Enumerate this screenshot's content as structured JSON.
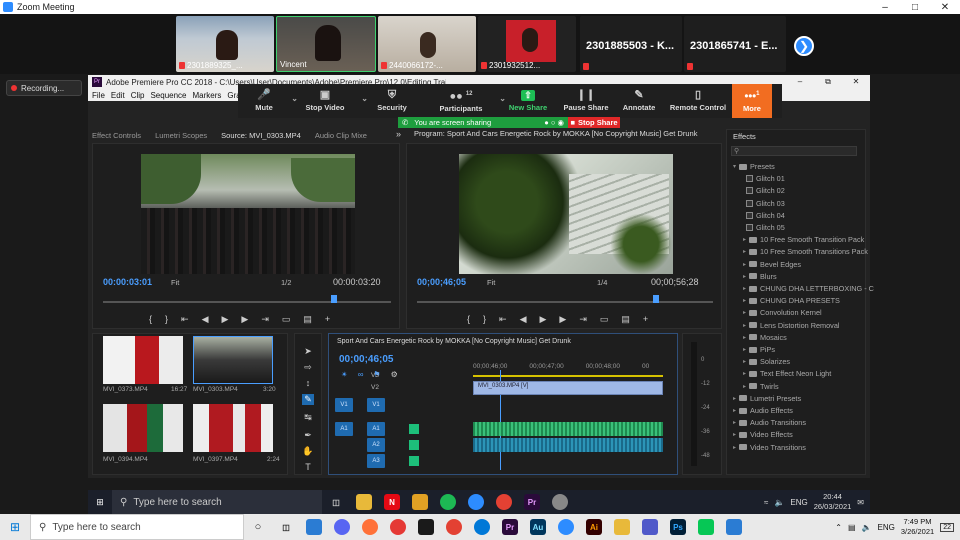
{
  "zoom": {
    "window_title": "Zoom Meeting",
    "participants": [
      {
        "name": "2301889325_..."
      },
      {
        "name": "Vincent"
      },
      {
        "name": "2440066172-..."
      },
      {
        "name": "2301932512..."
      }
    ],
    "big_names": [
      "2301885503 - K...",
      "2301865741 - E..."
    ],
    "recording_label": "Recording...",
    "toolbar": {
      "mute": "Mute",
      "stop_video": "Stop Video",
      "security": "Security",
      "participants": "Participants",
      "participants_count": "12",
      "new_share": "New Share",
      "pause_share": "Pause Share",
      "annotate": "Annotate",
      "remote_control": "Remote Control",
      "more": "More",
      "more_badge": "1"
    },
    "sharing_text": "You are screen sharing",
    "stop_share": "Stop Share"
  },
  "premiere": {
    "title": "Adobe Premiere Pro CC 2018 - C:\\Users\\User\\Documents\\Adobe\\Premiere Pro\\12.0\\Editing Training *",
    "menu": [
      "File",
      "Edit",
      "Clip",
      "Sequence",
      "Markers",
      "Graphics"
    ],
    "source_tabs": [
      "Effect Controls",
      "Lumetri Scopes",
      "Source: MVI_0303.MP4",
      "Audio Clip Mixe"
    ],
    "program_tab": "Program: Sport And Cars Energetic Rock by MOKKA [No Copyright Music] Get Drunk",
    "source": {
      "timecode": "00:00:03:01",
      "fit": "Fit",
      "ratio": "1/2",
      "duration": "00:00:03:20"
    },
    "program": {
      "timecode": "00;00;46;05",
      "fit": "Fit",
      "ratio": "1/4",
      "duration": "00;00;56;28"
    },
    "effects_tab": "Effects",
    "effects": [
      {
        "label": "Presets",
        "kind": "folder",
        "level": 0,
        "open": true
      },
      {
        "label": "Glitch 01",
        "kind": "preset",
        "level": 1
      },
      {
        "label": "Glitch 02",
        "kind": "preset",
        "level": 1
      },
      {
        "label": "Glitch 03",
        "kind": "preset",
        "level": 1
      },
      {
        "label": "Glitch 04",
        "kind": "preset",
        "level": 1
      },
      {
        "label": "Glitch 05",
        "kind": "preset",
        "level": 1
      },
      {
        "label": "10 Free Smooth Transition Pack",
        "kind": "folder",
        "level": 1
      },
      {
        "label": "10 Free Smooth Transitions Pack",
        "kind": "folder",
        "level": 1
      },
      {
        "label": "Bevel Edges",
        "kind": "folder",
        "level": 1
      },
      {
        "label": "Blurs",
        "kind": "folder",
        "level": 1
      },
      {
        "label": "CHUNG DHA LETTERBOXING - C",
        "kind": "folder",
        "level": 1
      },
      {
        "label": "CHUNG DHA PRESETS",
        "kind": "folder",
        "level": 1
      },
      {
        "label": "Convolution Kernel",
        "kind": "folder",
        "level": 1
      },
      {
        "label": "Lens Distortion Removal",
        "kind": "folder",
        "level": 1
      },
      {
        "label": "Mosaics",
        "kind": "folder",
        "level": 1
      },
      {
        "label": "PiPs",
        "kind": "folder",
        "level": 1
      },
      {
        "label": "Solarizes",
        "kind": "folder",
        "level": 1
      },
      {
        "label": "Text Effect Neon Light",
        "kind": "folder",
        "level": 1
      },
      {
        "label": "Twirls",
        "kind": "folder",
        "level": 1
      },
      {
        "label": "Lumetri Presets",
        "kind": "folder",
        "level": 0
      },
      {
        "label": "Audio Effects",
        "kind": "folder",
        "level": 0
      },
      {
        "label": "Audio Transitions",
        "kind": "folder",
        "level": 0
      },
      {
        "label": "Video Effects",
        "kind": "folder",
        "level": 0
      },
      {
        "label": "Video Transitions",
        "kind": "folder",
        "level": 0
      }
    ],
    "project_clips": [
      {
        "name": "MVI_0373.MP4",
        "dur": "16:27"
      },
      {
        "name": "MVI_0303.MP4",
        "dur": "3:20"
      },
      {
        "name": "MVI_0394.MP4",
        "dur": ""
      },
      {
        "name": "MVI_0397.MP4",
        "dur": "2:24"
      }
    ],
    "timeline": {
      "title": "Sport And Cars Energetic Rock by MOKKA [No Copyright Music] Get Drunk",
      "timecode": "00;00;46;05",
      "ruler": [
        "00;00;46;00",
        "00;00;47;00",
        "00;00;48;00",
        "00"
      ],
      "clip_v1": "MVI_0303.MP4 [V]",
      "tracks": [
        "V3",
        "V2",
        "V1",
        "A1",
        "A2",
        "A3"
      ],
      "meter": [
        "0",
        "-12",
        "-24",
        "-36",
        "-48"
      ]
    }
  },
  "taskbar_inner": {
    "search": "Type here to search",
    "lang": "ENG",
    "time": "20:44",
    "date": "26/03/2021"
  },
  "taskbar_outer": {
    "search": "Type here to search",
    "lang": "ENG",
    "time": "7:49 PM",
    "date": "3/26/2021",
    "notif": "22"
  }
}
